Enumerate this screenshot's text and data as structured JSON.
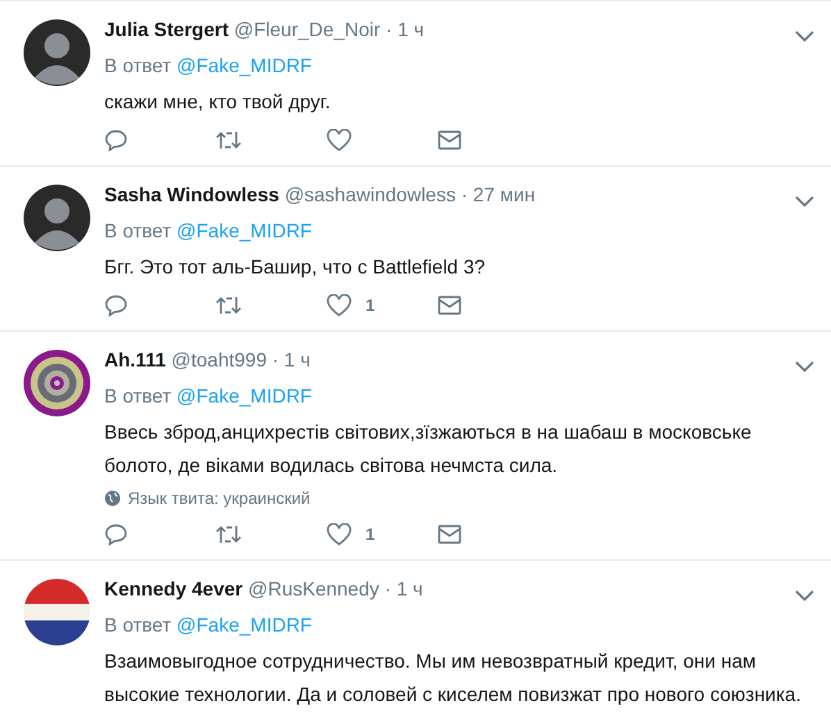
{
  "tweets": [
    {
      "name": "Julia Stergert",
      "handle": "@Fleur_De_Noir",
      "time": "· 1 ч",
      "reply_prefix": "В ответ",
      "reply_to": "@Fake_MIDRF",
      "text": "скажи мне, кто твой друг.",
      "actions_shown": true
    },
    {
      "name": "Sasha Windowless",
      "handle": "@sashawindowless",
      "time": "· 27 мин",
      "reply_prefix": "В ответ",
      "reply_to": "@Fake_MIDRF",
      "text": "Бгг. Это тот аль-Башир, что с Battlefield 3?",
      "actions_shown": true,
      "like_count": "1"
    },
    {
      "name": "Ah.111",
      "handle": "@toaht999",
      "time": "· 1 ч",
      "reply_prefix": "В ответ",
      "reply_to": "@Fake_MIDRF",
      "text": "Ввесь зброд,анцихрестів світових,зїзжаються в на шабаш в московське болото, де віками водилась світова нечмста сила.",
      "language_note": "Язык твита: украинский",
      "actions_shown": true,
      "like_count": "1"
    },
    {
      "name": "Kennedy 4ever",
      "handle": "@RusKennedy",
      "time": "· 1 ч",
      "reply_prefix": "В ответ",
      "reply_to": "@Fake_MIDRF",
      "text": "Взаимовыгодное сотрудничество. Мы им невозвратный кредит, они нам высокие технологии. Да и соловей с киселем повизжат про нового союзника.",
      "actions_shown": false
    }
  ]
}
